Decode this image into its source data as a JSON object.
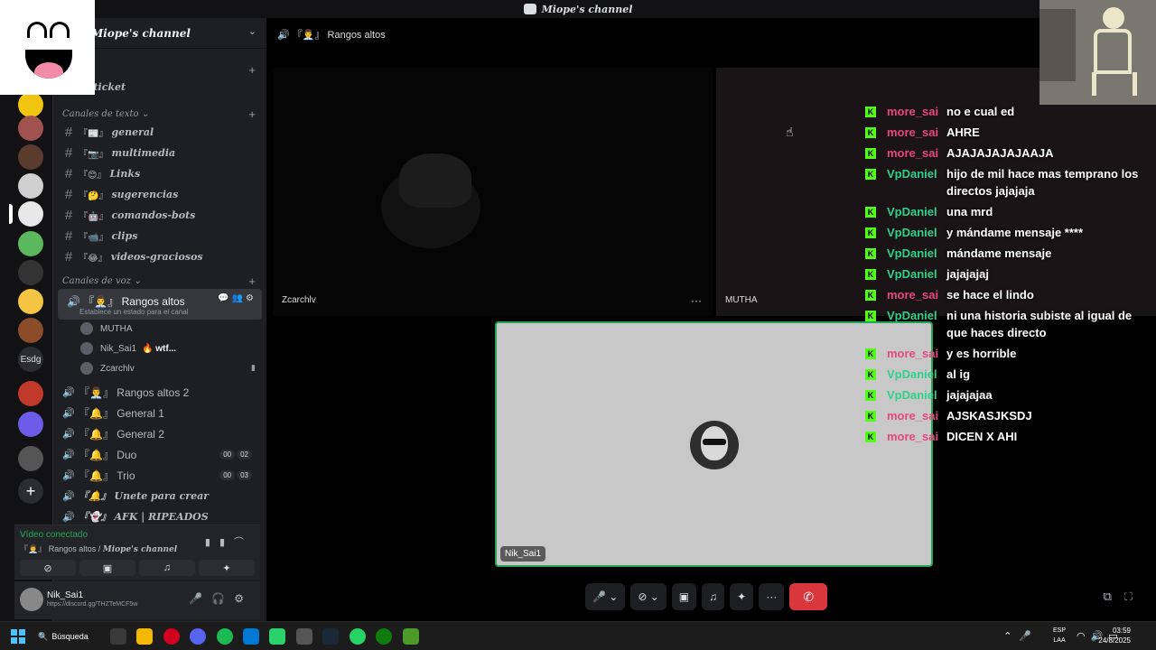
{
  "window": {
    "title": "Miope's channel"
  },
  "server": {
    "name": "Miope's channel",
    "chevron": "⌄",
    "servers_label": "Esdg"
  },
  "sidebar": {
    "top_channel": {
      "emoji": "🎫",
      "name": "ticket"
    },
    "text_category": "Canales de texto",
    "text_channels": [
      {
        "emoji": "『📰』",
        "name": "general"
      },
      {
        "emoji": "『📷』",
        "name": "multimedia"
      },
      {
        "emoji": "『😊』",
        "name": "Links"
      },
      {
        "emoji": "『🤔』",
        "name": "sugerencias"
      },
      {
        "emoji": "『🤖』",
        "name": "comandos-bots"
      },
      {
        "emoji": "『📹』",
        "name": "clips"
      },
      {
        "emoji": "『😂』",
        "name": "videos-graciosos"
      }
    ],
    "voice_category": "Canales de voz",
    "active_voice": {
      "name": "『👨‍💼』 Rangos altos",
      "status": "Establece un estado para el canal"
    },
    "members": [
      {
        "name": "MUTHA",
        "status": ""
      },
      {
        "name": "Nik_Sai1",
        "status": "🔥 wtf..."
      },
      {
        "name": "Zcarchlv",
        "status": ""
      }
    ],
    "voice_channels": [
      {
        "name": "『👨‍💼』 Rangos altos 2",
        "fancy": false,
        "badges": []
      },
      {
        "name": "『🔔』 General 1",
        "fancy": false,
        "badges": []
      },
      {
        "name": "『🔔』 General 2",
        "fancy": false,
        "badges": []
      },
      {
        "name": "『🔔』 Duo",
        "fancy": false,
        "badges": [
          "00",
          "02"
        ]
      },
      {
        "name": "『🔔』 Trio",
        "fancy": false,
        "badges": [
          "00",
          "03"
        ]
      },
      {
        "name": "『🔔』 Unete para crear",
        "fancy": true,
        "badges": []
      },
      {
        "name": "『👻』 AFK | RIPEADOS",
        "fancy": true,
        "badges": []
      }
    ]
  },
  "voice_panel": {
    "title": "Vídeo conectado",
    "channel": "『👨‍💼』 Rangos altos /",
    "server": "Miope's channel"
  },
  "user_panel": {
    "name": "Nik_Sai1",
    "link": "https://discord.gg/THZTeMCF5w"
  },
  "main": {
    "header": "『👨‍💼』 Rangos altos",
    "tiles": [
      {
        "label": "Zcarchlv"
      },
      {
        "label": "MUTHA"
      },
      {
        "label": "Nik_Sai1"
      }
    ],
    "more": "···"
  },
  "chat": [
    {
      "user": "more_sai",
      "color": "#e7467f",
      "text": "no e cual ed"
    },
    {
      "user": "more_sai",
      "color": "#e7467f",
      "text": "AHRE"
    },
    {
      "user": "more_sai",
      "color": "#e7467f",
      "text": "AJAJAJAJAJAAJA"
    },
    {
      "user": "VpDaniel",
      "color": "#2ed18c",
      "text": "hijo de mil hace mas temprano los directos jajajaja"
    },
    {
      "user": "VpDaniel",
      "color": "#2ed18c",
      "text": "una mrd"
    },
    {
      "user": "VpDaniel",
      "color": "#2ed18c",
      "text": "y mándame mensaje ****"
    },
    {
      "user": "VpDaniel",
      "color": "#2ed18c",
      "text": "mándame mensaje"
    },
    {
      "user": "VpDaniel",
      "color": "#2ed18c",
      "text": "jajajajaj"
    },
    {
      "user": "more_sai",
      "color": "#e7467f",
      "text": "se hace el lindo"
    },
    {
      "user": "VpDaniel",
      "color": "#2ed18c",
      "text": "ni una historia subiste al igual de que haces directo"
    },
    {
      "user": "more_sai",
      "color": "#e7467f",
      "text": "y es horrible"
    },
    {
      "user": "VpDaniel",
      "color": "#2ed18c",
      "text": "al ig"
    },
    {
      "user": "VpDaniel",
      "color": "#2ed18c",
      "text": "jajajajaa"
    },
    {
      "user": "more_sai",
      "color": "#e7467f",
      "text": "AJSKASJKSDJ"
    },
    {
      "user": "more_sai",
      "color": "#e7467f",
      "text": "DICEN X AHI"
    }
  ],
  "taskbar": {
    "search": "Búsqueda",
    "lang_top": "ESP",
    "lang_bottom": "LAA",
    "time": "03:59",
    "date": "24/8/2025"
  }
}
